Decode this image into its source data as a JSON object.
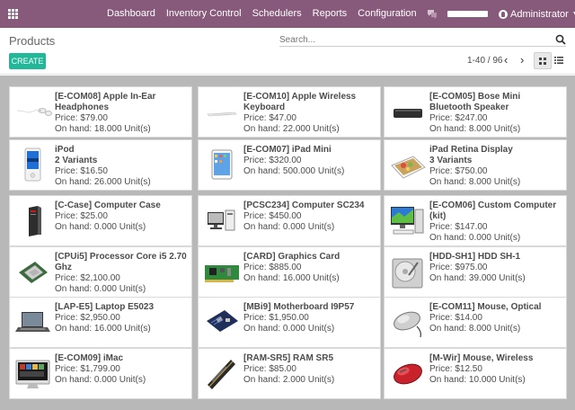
{
  "nav": {
    "menu": [
      "Dashboard",
      "Inventory Control",
      "Schedulers",
      "Reports",
      "Configuration"
    ],
    "user": "Administrator"
  },
  "page": {
    "breadcrumb": "Products",
    "search_placeholder": "Search...",
    "create_label": "CREATE",
    "pager": "1-40 / 96"
  },
  "products": [
    {
      "name": "[E-COM08] Apple In-Ear Headphones",
      "price": "Price: $79.00",
      "onhand": "On hand: 18.000 Unit(s)",
      "icon": "headphones"
    },
    {
      "name": "[E-COM10] Apple Wireless Keyboard",
      "price": "Price: $47.00",
      "onhand": "On hand: 22.000 Unit(s)",
      "icon": "keyboard"
    },
    {
      "name": "[E-COM05] Bose Mini Bluetooth Speaker",
      "price": "Price: $247.00",
      "onhand": "On hand: 8.000 Unit(s)",
      "icon": "speaker"
    },
    {
      "name": "iPod",
      "variants": "2 Variants",
      "price": "Price: $16.50",
      "onhand": "On hand: 26.000 Unit(s)",
      "icon": "ipod"
    },
    {
      "name": "[E-COM07] iPad Mini",
      "price": "Price: $320.00",
      "onhand": "On hand: 500.000 Unit(s)",
      "icon": "ipad"
    },
    {
      "name": "iPad Retina Display",
      "variants": "3 Variants",
      "price": "Price: $750.00",
      "onhand": "On hand: 8.000 Unit(s)",
      "icon": "ipad-retina"
    },
    {
      "name": "[C-Case] Computer Case",
      "price": "Price: $25.00",
      "onhand": "On hand: 0.000 Unit(s)",
      "icon": "computer-case"
    },
    {
      "name": "[PCSC234] Computer SC234",
      "price": "Price: $450.00",
      "onhand": "On hand: 0.000 Unit(s)",
      "icon": "computer"
    },
    {
      "name": "[E-COM06] Custom Computer (kit)",
      "price": "Price: $147.00",
      "onhand": "On hand: 0.000 Unit(s)",
      "icon": "computer-kit"
    },
    {
      "name": "[CPUi5] Processor Core i5 2.70 Ghz",
      "price": "Price: $2,100.00",
      "onhand": "On hand: 0.000 Unit(s)",
      "icon": "processor"
    },
    {
      "name": "[CARD] Graphics Card",
      "price": "Price: $885.00",
      "onhand": "On hand: 16.000 Unit(s)",
      "icon": "graphics-card"
    },
    {
      "name": "[HDD-SH1] HDD SH-1",
      "price": "Price: $975.00",
      "onhand": "On hand: 39.000 Unit(s)",
      "icon": "hdd"
    },
    {
      "name": "[LAP-E5] Laptop E5023",
      "price": "Price: $2,950.00",
      "onhand": "On hand: 16.000 Unit(s)",
      "icon": "laptop"
    },
    {
      "name": "[MBi9] Motherboard I9P57",
      "price": "Price: $1,950.00",
      "onhand": "On hand: 0.000 Unit(s)",
      "icon": "motherboard"
    },
    {
      "name": "[E-COM11] Mouse, Optical",
      "price": "Price: $14.00",
      "onhand": "On hand: 8.000 Unit(s)",
      "icon": "mouse-optical"
    },
    {
      "name": "[E-COM09] iMac",
      "price": "Price: $1,799.00",
      "onhand": "On hand: 0.000 Unit(s)",
      "icon": "imac"
    },
    {
      "name": "[RAM-SR5] RAM SR5",
      "price": "Price: $85.00",
      "onhand": "On hand: 2.000 Unit(s)",
      "icon": "ram"
    },
    {
      "name": "[M-Wir] Mouse, Wireless",
      "price": "Price: $12.50",
      "onhand": "On hand: 10.000 Unit(s)",
      "icon": "mouse-wireless"
    }
  ],
  "colors": {
    "brand": "#875a7b",
    "create": "#21b799",
    "kanban_bg": "#b8b8b8"
  }
}
